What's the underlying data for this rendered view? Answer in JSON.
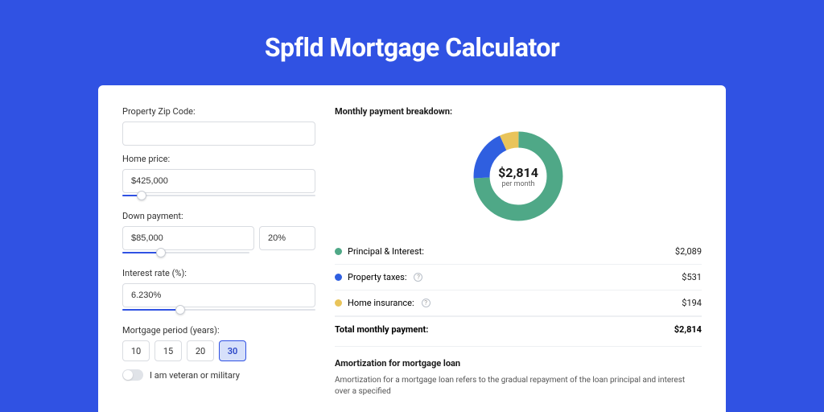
{
  "title": "Spfld Mortgage Calculator",
  "form": {
    "zip_label": "Property Zip Code:",
    "zip_value": "",
    "home_price_label": "Home price:",
    "home_price_value": "$425,000",
    "down_payment_label": "Down payment:",
    "down_payment_value": "$85,000",
    "down_payment_pct": "20%",
    "interest_rate_label": "Interest rate (%):",
    "interest_rate_value": "6.230%",
    "mortgage_period_label": "Mortgage period (years):",
    "terms": [
      "10",
      "15",
      "20",
      "30"
    ],
    "selected_term": "30",
    "veteran_label": "I am veteran or military"
  },
  "breakdown": {
    "title": "Monthly payment breakdown:",
    "center_amount": "$2,814",
    "center_sub": "per month",
    "rows": [
      {
        "label": "Principal & Interest:",
        "value": "$2,089",
        "color": "green",
        "has_info": false
      },
      {
        "label": "Property taxes:",
        "value": "$531",
        "color": "blue",
        "has_info": true
      },
      {
        "label": "Home insurance:",
        "value": "$194",
        "color": "yellow",
        "has_info": true
      }
    ],
    "total_label": "Total monthly payment:",
    "total_value": "$2,814"
  },
  "amortization": {
    "title": "Amortization for mortgage loan",
    "text": "Amortization for a mortgage loan refers to the gradual repayment of the loan principal and interest over a specified"
  },
  "chart_data": {
    "type": "pie",
    "title": "Monthly payment breakdown",
    "series": [
      {
        "name": "Principal & Interest",
        "value": 2089,
        "color": "#4fa887"
      },
      {
        "name": "Property taxes",
        "value": 531,
        "color": "#2f5fe0"
      },
      {
        "name": "Home insurance",
        "value": 194,
        "color": "#e9c45a"
      }
    ],
    "total": 2814,
    "center_label": "$2,814 per month"
  }
}
